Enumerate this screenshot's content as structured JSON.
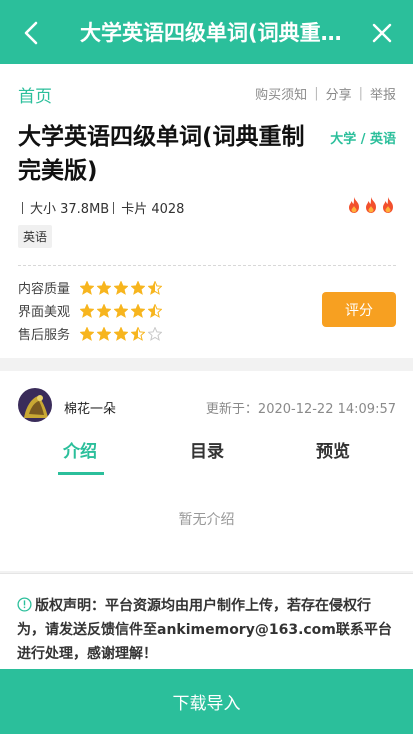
{
  "header": {
    "title": "大学英语四级单词(词典重制完美版)",
    "back_icon": "chevron-left-icon",
    "close_icon": "close-icon",
    "bg_color": "#2bbf9b"
  },
  "nav": {
    "home": "首页",
    "links": [
      "购买须知",
      "分享",
      "举报"
    ]
  },
  "deck": {
    "title": "大学英语四级单词(词典重制完美版)",
    "category": "大学 / 英语",
    "size": "大小 37.8MB",
    "cards": "卡片 4028",
    "heat_level": 3,
    "tag": "英语"
  },
  "ratings": [
    {
      "label": "内容质量",
      "stars": 4.5
    },
    {
      "label": "界面美观",
      "stars": 4.5
    },
    {
      "label": "售后服务",
      "stars": 3.5
    }
  ],
  "rate_button": "评分",
  "author": {
    "name": "棉花一朵",
    "updated": "更新于：2020-12-22 14:09:57"
  },
  "tabs": [
    "介绍",
    "目录",
    "预览"
  ],
  "active_tab": 0,
  "intro_empty": "暂无介绍",
  "copyright": "版权声明：平台资源均由用户制作上传，若存在侵权行为，请发送反馈信件至ankimemory@163.com联系平台进行处理，感谢理解！",
  "download_button": "下载导入",
  "colors": {
    "accent": "#2bbf9b",
    "star": "#f7b51e",
    "button_orange": "#f7a021",
    "flame": "#f2502d"
  }
}
